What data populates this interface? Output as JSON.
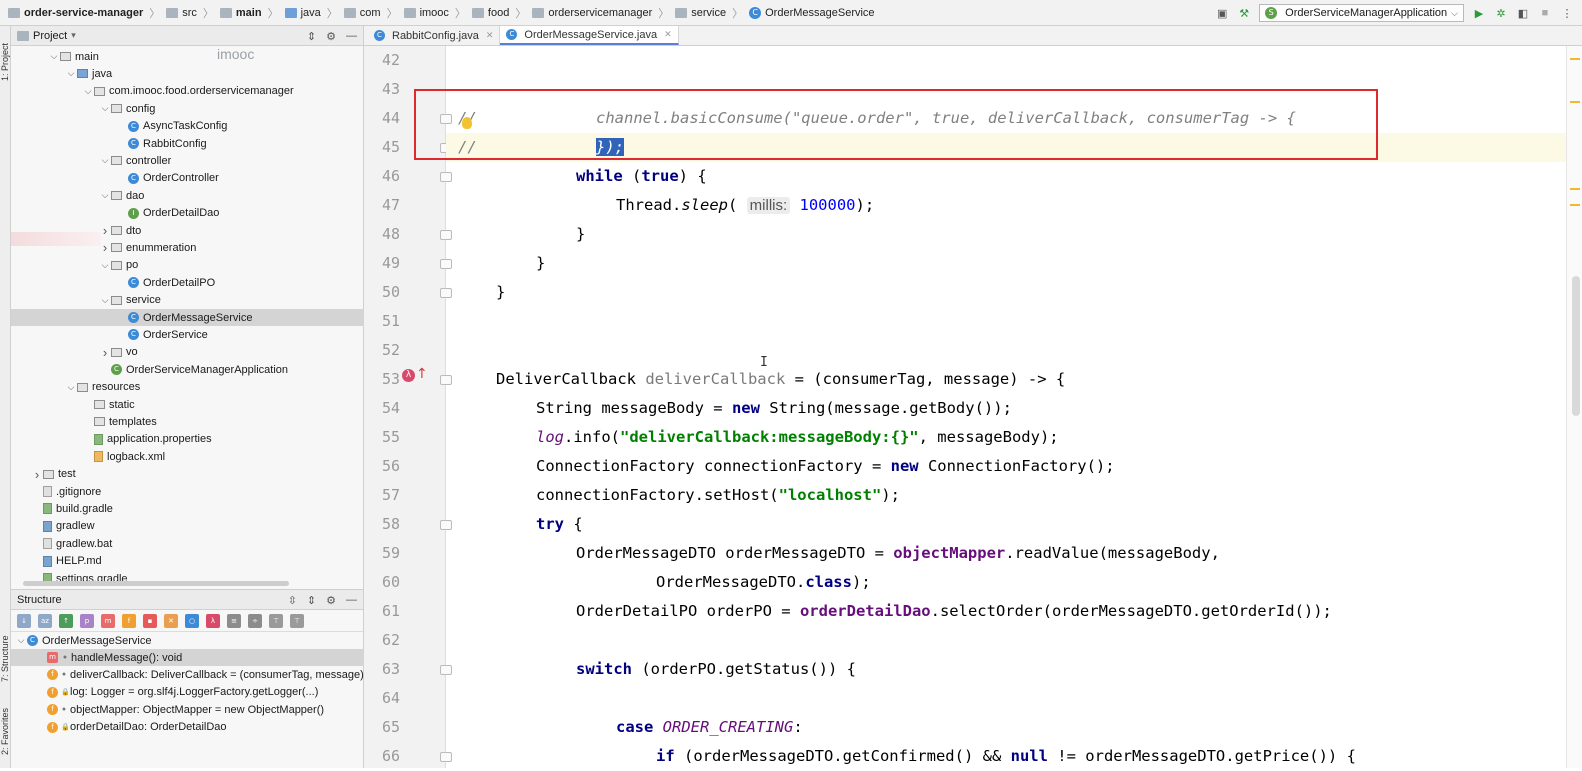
{
  "breadcrumbs": [
    "order-service-manager",
    "src",
    "main",
    "java",
    "com",
    "imooc",
    "food",
    "orderservicemanager",
    "service",
    "OrderMessageService"
  ],
  "run_config": "OrderServiceManagerApplication",
  "watermark": "imooc",
  "left_tabs": {
    "project": "1: Project",
    "structure": "7: Structure",
    "favorites": "2: Favorites"
  },
  "project_panel": {
    "title": "Project",
    "tree": [
      {
        "label": "main",
        "depth": 3,
        "arrow": "down",
        "icon": "folder"
      },
      {
        "label": "java",
        "depth": 4,
        "arrow": "down",
        "icon": "bluefolder"
      },
      {
        "label": "com.imooc.food.orderservicemanager",
        "depth": 5,
        "arrow": "down",
        "icon": "package"
      },
      {
        "label": "config",
        "depth": 6,
        "arrow": "down",
        "icon": "package"
      },
      {
        "label": "AsyncTaskConfig",
        "depth": 7,
        "arrow": "",
        "icon": "class"
      },
      {
        "label": "RabbitConfig",
        "depth": 7,
        "arrow": "",
        "icon": "class"
      },
      {
        "label": "controller",
        "depth": 6,
        "arrow": "down",
        "icon": "package"
      },
      {
        "label": "OrderController",
        "depth": 7,
        "arrow": "",
        "icon": "class"
      },
      {
        "label": "dao",
        "depth": 6,
        "arrow": "down",
        "icon": "package"
      },
      {
        "label": "OrderDetailDao",
        "depth": 7,
        "arrow": "",
        "icon": "interface"
      },
      {
        "label": "dto",
        "depth": 6,
        "arrow": "right",
        "icon": "package"
      },
      {
        "label": "enummeration",
        "depth": 6,
        "arrow": "right",
        "icon": "package"
      },
      {
        "label": "po",
        "depth": 6,
        "arrow": "down",
        "icon": "package"
      },
      {
        "label": "OrderDetailPO",
        "depth": 7,
        "arrow": "",
        "icon": "class"
      },
      {
        "label": "service",
        "depth": 6,
        "arrow": "down",
        "icon": "package"
      },
      {
        "label": "OrderMessageService",
        "depth": 7,
        "arrow": "",
        "icon": "class",
        "selected": true
      },
      {
        "label": "OrderService",
        "depth": 7,
        "arrow": "",
        "icon": "class"
      },
      {
        "label": "vo",
        "depth": 6,
        "arrow": "right",
        "icon": "package"
      },
      {
        "label": "OrderServiceManagerApplication",
        "depth": 6,
        "arrow": "",
        "icon": "springclass"
      },
      {
        "label": "resources",
        "depth": 4,
        "arrow": "down",
        "icon": "folder"
      },
      {
        "label": "static",
        "depth": 5,
        "arrow": "",
        "icon": "folder"
      },
      {
        "label": "templates",
        "depth": 5,
        "arrow": "",
        "icon": "folder"
      },
      {
        "label": "application.properties",
        "depth": 5,
        "arrow": "",
        "icon": "gfile"
      },
      {
        "label": "logback.xml",
        "depth": 5,
        "arrow": "",
        "icon": "ofile"
      },
      {
        "label": "test",
        "depth": 2,
        "arrow": "right",
        "icon": "folder"
      },
      {
        "label": ".gitignore",
        "depth": 2,
        "arrow": "",
        "icon": "file"
      },
      {
        "label": "build.gradle",
        "depth": 2,
        "arrow": "",
        "icon": "gfile"
      },
      {
        "label": "gradlew",
        "depth": 2,
        "arrow": "",
        "icon": "bfile"
      },
      {
        "label": "gradlew.bat",
        "depth": 2,
        "arrow": "",
        "icon": "file"
      },
      {
        "label": "HELP.md",
        "depth": 2,
        "arrow": "",
        "icon": "bfile"
      },
      {
        "label": "settings.gradle",
        "depth": 2,
        "arrow": "",
        "icon": "gfile"
      }
    ]
  },
  "structure_panel": {
    "title": "Structure",
    "root": "OrderMessageService",
    "items": [
      {
        "kind": "method",
        "label": "handleMessage(): void",
        "selected": true
      },
      {
        "kind": "field",
        "label": "deliverCallback: DeliverCallback = (consumerTag, message)"
      },
      {
        "kind": "field-private",
        "label": "log: Logger = org.slf4j.LoggerFactory.getLogger(...)"
      },
      {
        "kind": "field",
        "label": "objectMapper: ObjectMapper = new ObjectMapper()"
      },
      {
        "kind": "field-private",
        "label": "orderDetailDao: OrderDetailDao"
      }
    ]
  },
  "editor_tabs": [
    {
      "label": "RabbitConfig.java",
      "active": false
    },
    {
      "label": "OrderMessageService.java",
      "active": true
    }
  ],
  "line_numbers": [
    "42",
    "43",
    "44",
    "45",
    "46",
    "47",
    "48",
    "49",
    "50",
    "51",
    "52",
    "53",
    "54",
    "55",
    "56",
    "57",
    "58",
    "59",
    "60",
    "61",
    "62",
    "63",
    "64",
    "65",
    "66"
  ],
  "code": {
    "l44": "channel.basicConsume(\"queue.order\", true, deliverCallback, consumerTag -> {",
    "l44_gutter": "//",
    "l45_gutter": "//",
    "l45_sel": "});",
    "l46_kw": "while",
    "l46_true": "true",
    "l46_rest": ") {",
    "l47_a": "Thread.",
    "l47_sleep": "sleep",
    "l47_hint": "millis:",
    "l47_num": "100000",
    "l47_end": ");",
    "brace": "}",
    "l53_a": "DeliverCallback ",
    "l53_var": "deliverCallback",
    "l53_b": " = (consumerTag, message) -> {",
    "l54_a": "String messageBody = ",
    "l54_new": "new",
    "l54_b": " String(message.getBody());",
    "l55_log": "log",
    "l55_a": ".info(",
    "l55_str": "\"deliverCallback:messageBody:{}\"",
    "l55_b": ", messageBody);",
    "l56_a": "ConnectionFactory connectionFactory = ",
    "l56_new": "new",
    "l56_b": " ConnectionFactory();",
    "l57_a": "connectionFactory.setHost(",
    "l57_str": "\"localhost\"",
    "l57_b": ");",
    "l58_try": "try",
    "l58_b": " {",
    "l59_a": "OrderMessageDTO orderMessageDTO = ",
    "l59_fd": "objectMapper",
    "l59_b": ".readValue(messageBody,",
    "l60_a": "OrderMessageDTO.",
    "l60_kw": "class",
    "l60_b": ");",
    "l61_a": "OrderDetailPO orderPO = ",
    "l61_fd": "orderDetailDao",
    "l61_b": ".selectOrder(orderMessageDTO.getOrderId());",
    "l63_kw": "switch",
    "l63_b": " (orderPO.getStatus()) {",
    "l65_kw": "case",
    "l65_const": "ORDER_CREATING",
    "l65_b": ":",
    "l66_kw": "if",
    "l66_a": " (orderMessageDTO.getConfirmed() && ",
    "l66_null": "null",
    "l66_b": " != orderMessageDTO.getPrice()) {"
  }
}
